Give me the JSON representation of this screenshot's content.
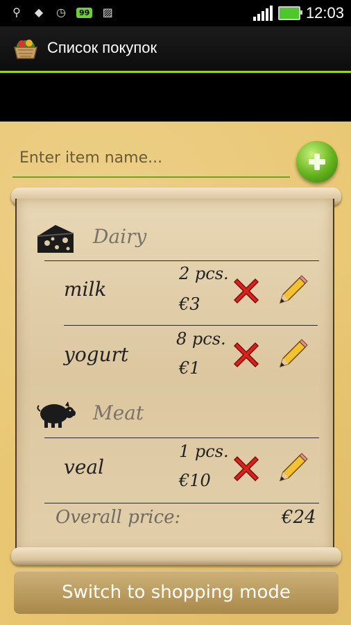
{
  "status_bar": {
    "battery_badge": "99",
    "time": "12:03"
  },
  "action_bar": {
    "title": "Список покупок"
  },
  "input": {
    "placeholder": "Enter item name..."
  },
  "categories": [
    {
      "name": "Dairy",
      "icon": "cheese-icon",
      "items": [
        {
          "name": "milk",
          "qty": "2 pcs.",
          "price": "€3"
        },
        {
          "name": "yogurt",
          "qty": "8 pcs.",
          "price": "€1"
        }
      ]
    },
    {
      "name": "Meat",
      "icon": "pig-icon",
      "items": [
        {
          "name": "veal",
          "qty": "1 pcs.",
          "price": "€10"
        }
      ]
    }
  ],
  "overall": {
    "label": "Overall price:",
    "value": "€24"
  },
  "switch_button": "Switch to shopping mode",
  "colors": {
    "accent_green": "#9bd31b",
    "paper": "#e9c773",
    "delete_red": "#d8231b"
  }
}
